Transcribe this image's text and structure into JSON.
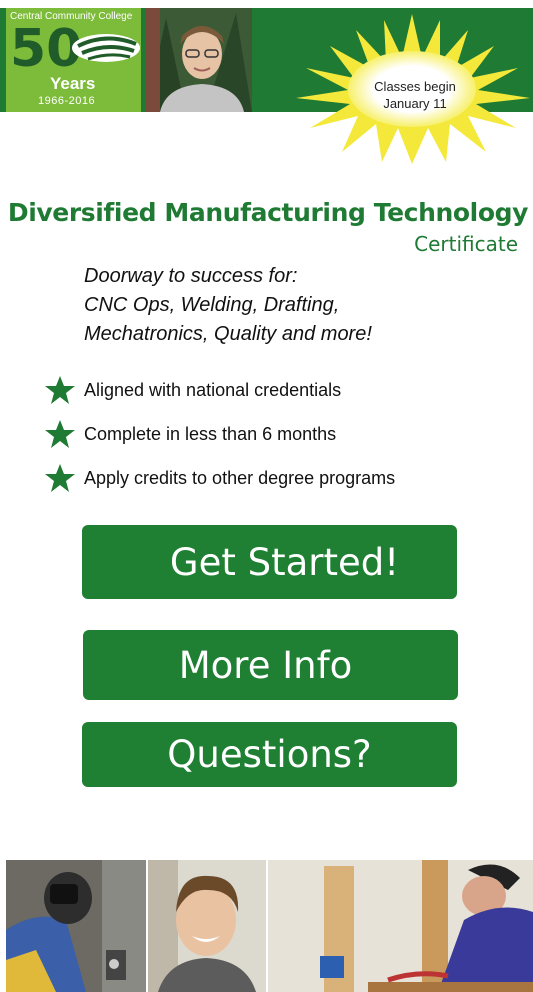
{
  "header": {
    "logo": {
      "school_name": "Central Community College",
      "anniversary_number": "50",
      "years_label": "Years",
      "year_span": "1966-2016"
    },
    "announcement": "Classes begin January 11"
  },
  "program": {
    "title": "Diversified Manufacturing Technology",
    "subtitle": "Certificate",
    "tagline_lines": [
      "Doorway to success for:",
      "CNC Ops, Welding, Drafting,",
      "Mechatronics, Quality and more!"
    ]
  },
  "features": [
    {
      "icon": "star-icon",
      "text": "Aligned with national credentials"
    },
    {
      "icon": "star-icon",
      "text": "Complete in less than 6 months"
    },
    {
      "icon": "star-icon",
      "text": "Apply credits to other degree programs"
    }
  ],
  "buttons": {
    "get_started": "Get Started!",
    "more_info": "More Info",
    "questions": "Questions?"
  },
  "colors": {
    "brand_green": "#1f7a34",
    "logo_green": "#7dbb3a",
    "burst_yellow": "#f4e93a",
    "button_text": "#ffffff"
  }
}
